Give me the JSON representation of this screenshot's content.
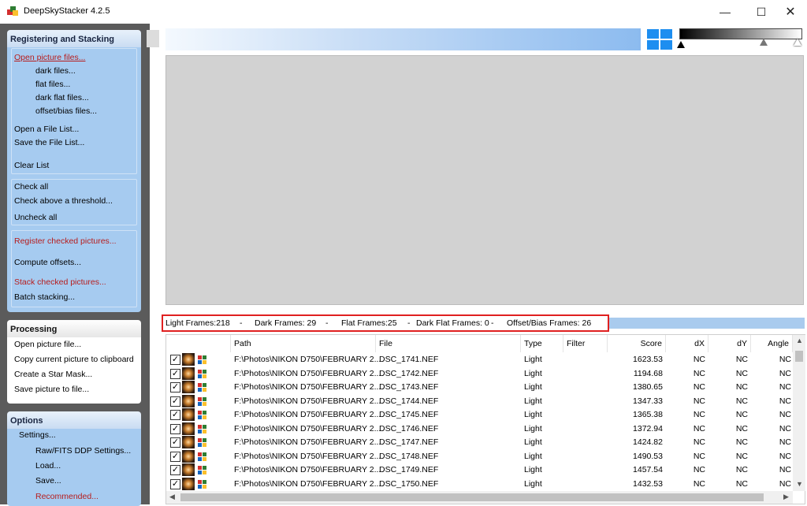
{
  "window": {
    "title": "DeepSkyStacker 4.2.5",
    "buttons": {
      "minimize": "—",
      "maximize": "☐",
      "close": "✕"
    }
  },
  "panels": {
    "registering": {
      "title": "Registering and Stacking",
      "open_picture_files": "Open picture files...",
      "dark_files": "dark files...",
      "flat_files": "flat files...",
      "dark_flat_files": "dark flat files...",
      "offset_bias_files": "offset/bias files...",
      "open_file_list": "Open a File List...",
      "save_file_list": "Save the File List...",
      "clear_list": "Clear List",
      "check_all": "Check all",
      "check_above_threshold": "Check above a threshold...",
      "uncheck_all": "Uncheck all",
      "register_checked": "Register checked pictures...",
      "compute_offsets": "Compute offsets...",
      "stack_checked": "Stack checked pictures...",
      "batch_stacking": "Batch stacking..."
    },
    "processing": {
      "title": "Processing",
      "open_picture_file": "Open picture file...",
      "copy_to_clipboard": "Copy current picture to clipboard",
      "create_star_mask": "Create a Star Mask...",
      "save_picture": "Save picture to file..."
    },
    "options": {
      "title": "Options",
      "settings": "Settings...",
      "raw_fits": "Raw/FITS DDP Settings...",
      "load": "Load...",
      "save": "Save...",
      "recommended": "Recommended..."
    }
  },
  "frame_counts": {
    "light": "Light Frames:218",
    "sep": "-",
    "dark": "Dark Frames: 29",
    "flat": "Flat Frames:25",
    "dark_flat": "Dark Flat Frames: 0",
    "offset_bias": "Offset/Bias Frames: 26"
  },
  "table": {
    "columns": [
      "Path",
      "File",
      "Type",
      "Filter",
      "Score",
      "dX",
      "dY",
      "Angle"
    ],
    "rows": [
      {
        "path": "F:\\Photos\\NIKON D750\\FEBRUARY 2...",
        "file": "DSC_1741.NEF",
        "type": "Light",
        "filter": "",
        "score": "1623.53",
        "dx": "NC",
        "dy": "NC",
        "angle": "NC"
      },
      {
        "path": "F:\\Photos\\NIKON D750\\FEBRUARY 2...",
        "file": "DSC_1742.NEF",
        "type": "Light",
        "filter": "",
        "score": "1194.68",
        "dx": "NC",
        "dy": "NC",
        "angle": "NC"
      },
      {
        "path": "F:\\Photos\\NIKON D750\\FEBRUARY 2...",
        "file": "DSC_1743.NEF",
        "type": "Light",
        "filter": "",
        "score": "1380.65",
        "dx": "NC",
        "dy": "NC",
        "angle": "NC"
      },
      {
        "path": "F:\\Photos\\NIKON D750\\FEBRUARY 2...",
        "file": "DSC_1744.NEF",
        "type": "Light",
        "filter": "",
        "score": "1347.33",
        "dx": "NC",
        "dy": "NC",
        "angle": "NC"
      },
      {
        "path": "F:\\Photos\\NIKON D750\\FEBRUARY 2...",
        "file": "DSC_1745.NEF",
        "type": "Light",
        "filter": "",
        "score": "1365.38",
        "dx": "NC",
        "dy": "NC",
        "angle": "NC"
      },
      {
        "path": "F:\\Photos\\NIKON D750\\FEBRUARY 2...",
        "file": "DSC_1746.NEF",
        "type": "Light",
        "filter": "",
        "score": "1372.94",
        "dx": "NC",
        "dy": "NC",
        "angle": "NC"
      },
      {
        "path": "F:\\Photos\\NIKON D750\\FEBRUARY 2...",
        "file": "DSC_1747.NEF",
        "type": "Light",
        "filter": "",
        "score": "1424.82",
        "dx": "NC",
        "dy": "NC",
        "angle": "NC"
      },
      {
        "path": "F:\\Photos\\NIKON D750\\FEBRUARY 2...",
        "file": "DSC_1748.NEF",
        "type": "Light",
        "filter": "",
        "score": "1490.53",
        "dx": "NC",
        "dy": "NC",
        "angle": "NC"
      },
      {
        "path": "F:\\Photos\\NIKON D750\\FEBRUARY 2...",
        "file": "DSC_1749.NEF",
        "type": "Light",
        "filter": "",
        "score": "1457.54",
        "dx": "NC",
        "dy": "NC",
        "angle": "NC"
      },
      {
        "path": "F:\\Photos\\NIKON D750\\FEBRUARY 2...",
        "file": "DSC_1750.NEF",
        "type": "Light",
        "filter": "",
        "score": "1432.53",
        "dx": "NC",
        "dy": "NC",
        "angle": "NC"
      }
    ]
  },
  "colors": {
    "panel_background": "#5b5b5b",
    "group_blue": "#a6cbf0",
    "link_red": "#b71c1c",
    "highlight_box": "#e02020"
  }
}
